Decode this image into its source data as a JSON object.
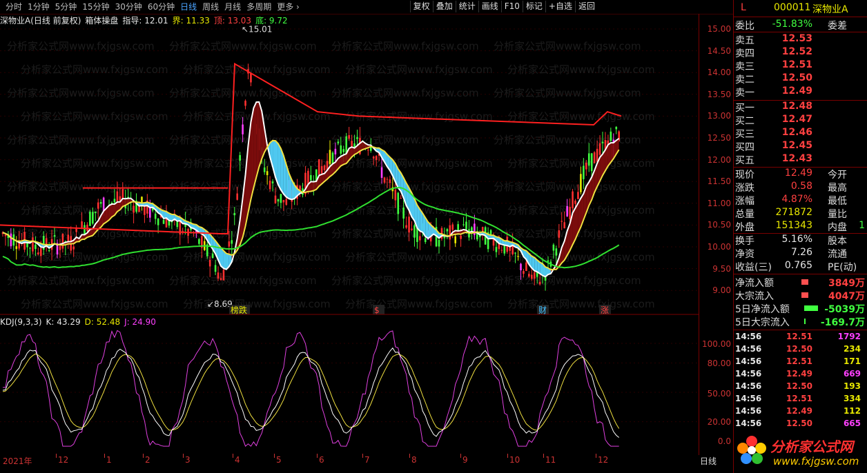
{
  "toolbar": {
    "periods": [
      "分时",
      "1分钟",
      "5分钟",
      "15分钟",
      "30分钟",
      "60分钟",
      "日线",
      "周线",
      "月线",
      "多周期",
      "更多 ›"
    ],
    "active_period": "日线",
    "tools": [
      "复权",
      "叠加",
      "统计",
      "画线",
      "F10",
      "标记",
      "+自选",
      "返回"
    ]
  },
  "info": {
    "stock": "深物业A(日线 前复权)",
    "indicator": "箱体操盘",
    "zhidao": "指导: 12.01",
    "jie": "界: 11.33",
    "ding": "顶: 13.03",
    "di": "底: 9.72"
  },
  "price_axis": [
    "15.00",
    "14.50",
    "14.00",
    "13.50",
    "13.00",
    "12.50",
    "12.00",
    "11.50",
    "11.00",
    "10.50",
    "10.00",
    "9.50",
    "9.00"
  ],
  "annotations": {
    "high": "15.01",
    "low": "8.69"
  },
  "event_tags": [
    "榜跌",
    "$",
    "财",
    "涨"
  ],
  "kdj": {
    "name": "KDJ(9,3,3)",
    "k": "K: 43.29",
    "d": "D: 52.48",
    "j": "J: 24.90",
    "axis": [
      "100.00",
      "80.00",
      "50.00",
      "20.00",
      "0.0"
    ]
  },
  "x_axis": [
    "2021年",
    "12",
    "1",
    "2",
    "3",
    "4",
    "5",
    "6",
    "7",
    "8",
    "9",
    "10",
    "11",
    "12"
  ],
  "period_badge": "日线",
  "watermark": "分析家公式网www.fxjgsw.com",
  "panel": {
    "code_prefix": "L",
    "code": "000011",
    "name": "深物业A",
    "weibi_label": "委比",
    "weibi": "-51.83%",
    "weicha_label": "委差",
    "asks": [
      {
        "label": "卖五",
        "price": "12.53"
      },
      {
        "label": "卖四",
        "price": "12.52"
      },
      {
        "label": "卖三",
        "price": "12.51"
      },
      {
        "label": "卖二",
        "price": "12.50"
      },
      {
        "label": "卖一",
        "price": "12.49"
      }
    ],
    "bids": [
      {
        "label": "买一",
        "price": "12.48"
      },
      {
        "label": "买二",
        "price": "12.47"
      },
      {
        "label": "买三",
        "price": "12.46"
      },
      {
        "label": "买四",
        "price": "12.45"
      },
      {
        "label": "买五",
        "price": "12.43"
      }
    ],
    "stats": [
      {
        "label": "现价",
        "value": "12.49",
        "label2": "今开"
      },
      {
        "label": "涨跌",
        "value": "0.58",
        "label2": "最高"
      },
      {
        "label": "涨幅",
        "value": "4.87%",
        "label2": "最低"
      },
      {
        "label": "总量",
        "value": "271872",
        "label2": "量比"
      },
      {
        "label": "外盘",
        "value": "151343",
        "label2": "内盘",
        "extra": "1"
      }
    ],
    "stats2": [
      {
        "label": "换手",
        "value": "5.16%",
        "label2": "股本"
      },
      {
        "label": "净资",
        "value": "7.26",
        "label2": "流通"
      },
      {
        "label": "收益(三)",
        "value": "0.765",
        "label2": "PE(动)"
      }
    ],
    "flows": [
      {
        "label": "净流入额",
        "value": "3849万",
        "color": "#ff5050",
        "bar": 0.45
      },
      {
        "label": "大宗流入",
        "value": "4047万",
        "color": "#ff5050",
        "bar": 0.45
      },
      {
        "label": "5日净流入额",
        "value": "-5039万",
        "color": "#40ff40",
        "bar": 0.9
      },
      {
        "label": "5日大宗流入",
        "value": "-169.7万",
        "color": "#40ff40",
        "bar": 0.05
      }
    ],
    "ticks": [
      {
        "time": "14:56",
        "price": "12.51",
        "vol": "1792",
        "color": "#ff40ff"
      },
      {
        "time": "14:56",
        "price": "12.50",
        "vol": "234",
        "color": "#e8e800"
      },
      {
        "time": "14:56",
        "price": "12.51",
        "vol": "171",
        "color": "#e8e800"
      },
      {
        "time": "14:56",
        "price": "12.49",
        "vol": "669",
        "color": "#ff40ff"
      },
      {
        "time": "14:56",
        "price": "12.50",
        "vol": "193",
        "color": "#e8e800"
      },
      {
        "time": "14:56",
        "price": "12.51",
        "vol": "334",
        "color": "#e8e800"
      },
      {
        "time": "14:56",
        "price": "12.49",
        "vol": "112",
        "color": "#e8e800"
      },
      {
        "time": "14:56",
        "price": "12.50",
        "vol": "665",
        "color": "#ff40ff"
      }
    ],
    "logo_cn": "分析家公式网",
    "logo_url": "www.fxjgsw.com"
  }
}
